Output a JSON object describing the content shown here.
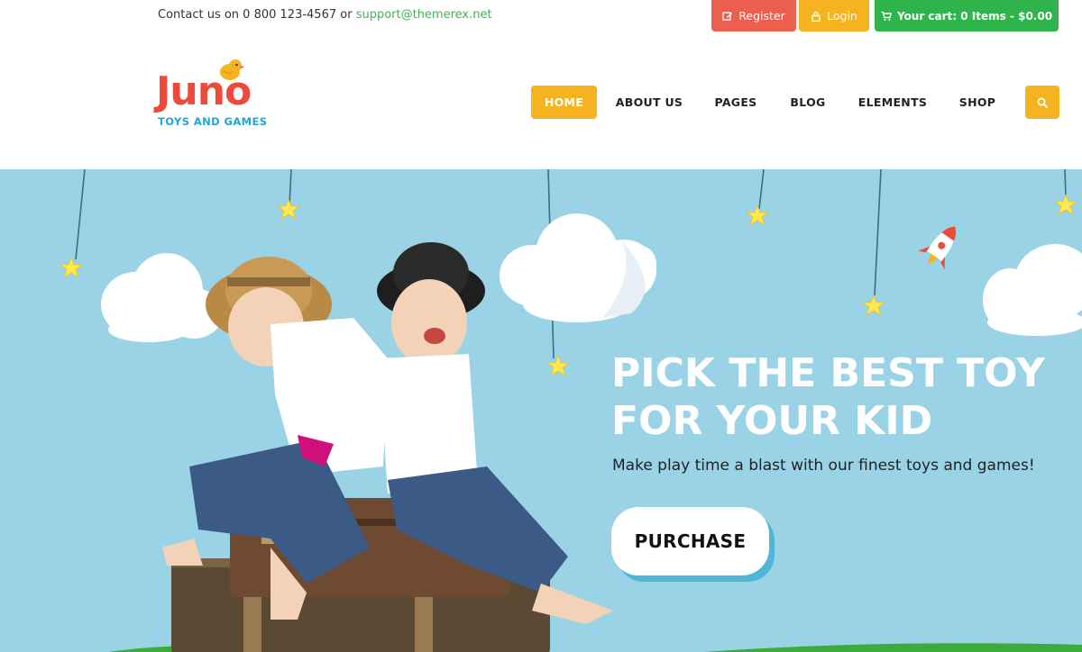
{
  "topbar": {
    "contact_prefix": "Contact us on 0 800 123-4567 or ",
    "contact_email": "support@themerex.net",
    "register_label": "Register",
    "login_label": "Login",
    "cart_label": "Your cart: 0 Items - $0.00"
  },
  "logo": {
    "word": "Juno",
    "tagline": "TOYS AND GAMES"
  },
  "nav": {
    "items": [
      {
        "label": "HOME",
        "active": true
      },
      {
        "label": "ABOUT US",
        "active": false
      },
      {
        "label": "PAGES",
        "active": false
      },
      {
        "label": "BLOG",
        "active": false
      },
      {
        "label": "ELEMENTS",
        "active": false
      },
      {
        "label": "SHOP",
        "active": false
      }
    ],
    "search_icon": "search-icon"
  },
  "hero": {
    "headline_line1": "PICK THE BEST TOY",
    "headline_line2": "FOR YOUR KID",
    "subtitle": "Make play time a blast with our finest toys and games!",
    "button_label": "PURCHASE"
  },
  "colors": {
    "register": "#ec5f4f",
    "login": "#f5b320",
    "cart": "#2fb44b",
    "accent": "#f5b320",
    "email": "#3fb34f",
    "logo_red": "#ec4b3a",
    "logo_blue": "#1ea7d8",
    "hero_bg": "#9bd3e6",
    "button_shadow": "#4fb6d6",
    "star": "#ffe94d",
    "grass": "#3cab3c"
  }
}
